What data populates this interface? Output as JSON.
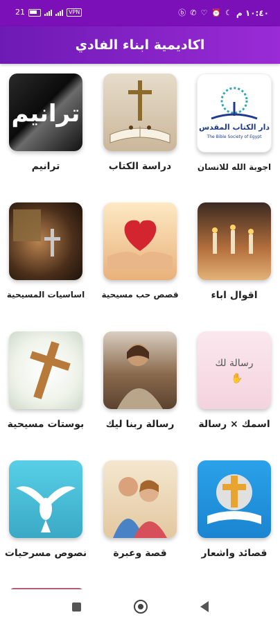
{
  "status_bar": {
    "time": "١٠:٤٠ م",
    "left_text": "21",
    "vpn": "VPN",
    "icons": [
      "battery-icon",
      "signal-icon",
      "signal-icon",
      "vpn-icon",
      "b-icon",
      "phone-icon",
      "heart-icon",
      "alarm-icon",
      "moon-icon"
    ]
  },
  "app": {
    "title": "اكاديمية ابناء الفادي",
    "bar_color": "#7b0fb8"
  },
  "tiles": [
    {
      "label": "ترانيم",
      "thumb_text": "ترانيم"
    },
    {
      "label": "دراسة الكتاب"
    },
    {
      "label": "اجوبة الله للانسان",
      "logo_ar": "دار الكتاب المقدس",
      "logo_en": "The Bible Society of Egypt"
    },
    {
      "label": "اساسيات المسيحية"
    },
    {
      "label": "قصص حب مسيحية"
    },
    {
      "label": "اقوال اباء"
    },
    {
      "label": "بوستات مسيحية"
    },
    {
      "label": "رسالة ربنا ليك"
    },
    {
      "label": "اسمك × رسالة",
      "thumb_text": "رسالة لك"
    },
    {
      "label": "نصوص مسرحيات"
    },
    {
      "label": "قصة وعبرة"
    },
    {
      "label": "قصائد واشعار"
    }
  ],
  "nav": {
    "icons": [
      "recents-icon",
      "home-icon",
      "back-icon"
    ]
  }
}
